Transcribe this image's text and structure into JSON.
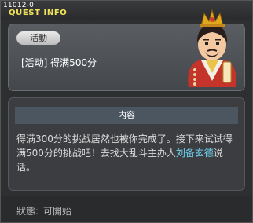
{
  "header": {
    "quest_id": "11012-0",
    "title": "QUEST INFO"
  },
  "quest": {
    "tag": "活動",
    "name": "[活动] 得满500分"
  },
  "content": {
    "heading": "内容",
    "text_before": "得满300分的挑战居然也被你完成了。接下来试试得满500分的挑战吧！去找大乱斗主办人",
    "npc_name": "刘备玄德",
    "text_after": "说话。"
  },
  "status": {
    "label": "狀態:",
    "value": "可開始"
  },
  "colors": {
    "title": "#f2e45a",
    "npc_link": "#6fd4f2",
    "panel": "#4a4d52"
  },
  "icons": {
    "avatar": "liu-bei-npc-portrait"
  }
}
